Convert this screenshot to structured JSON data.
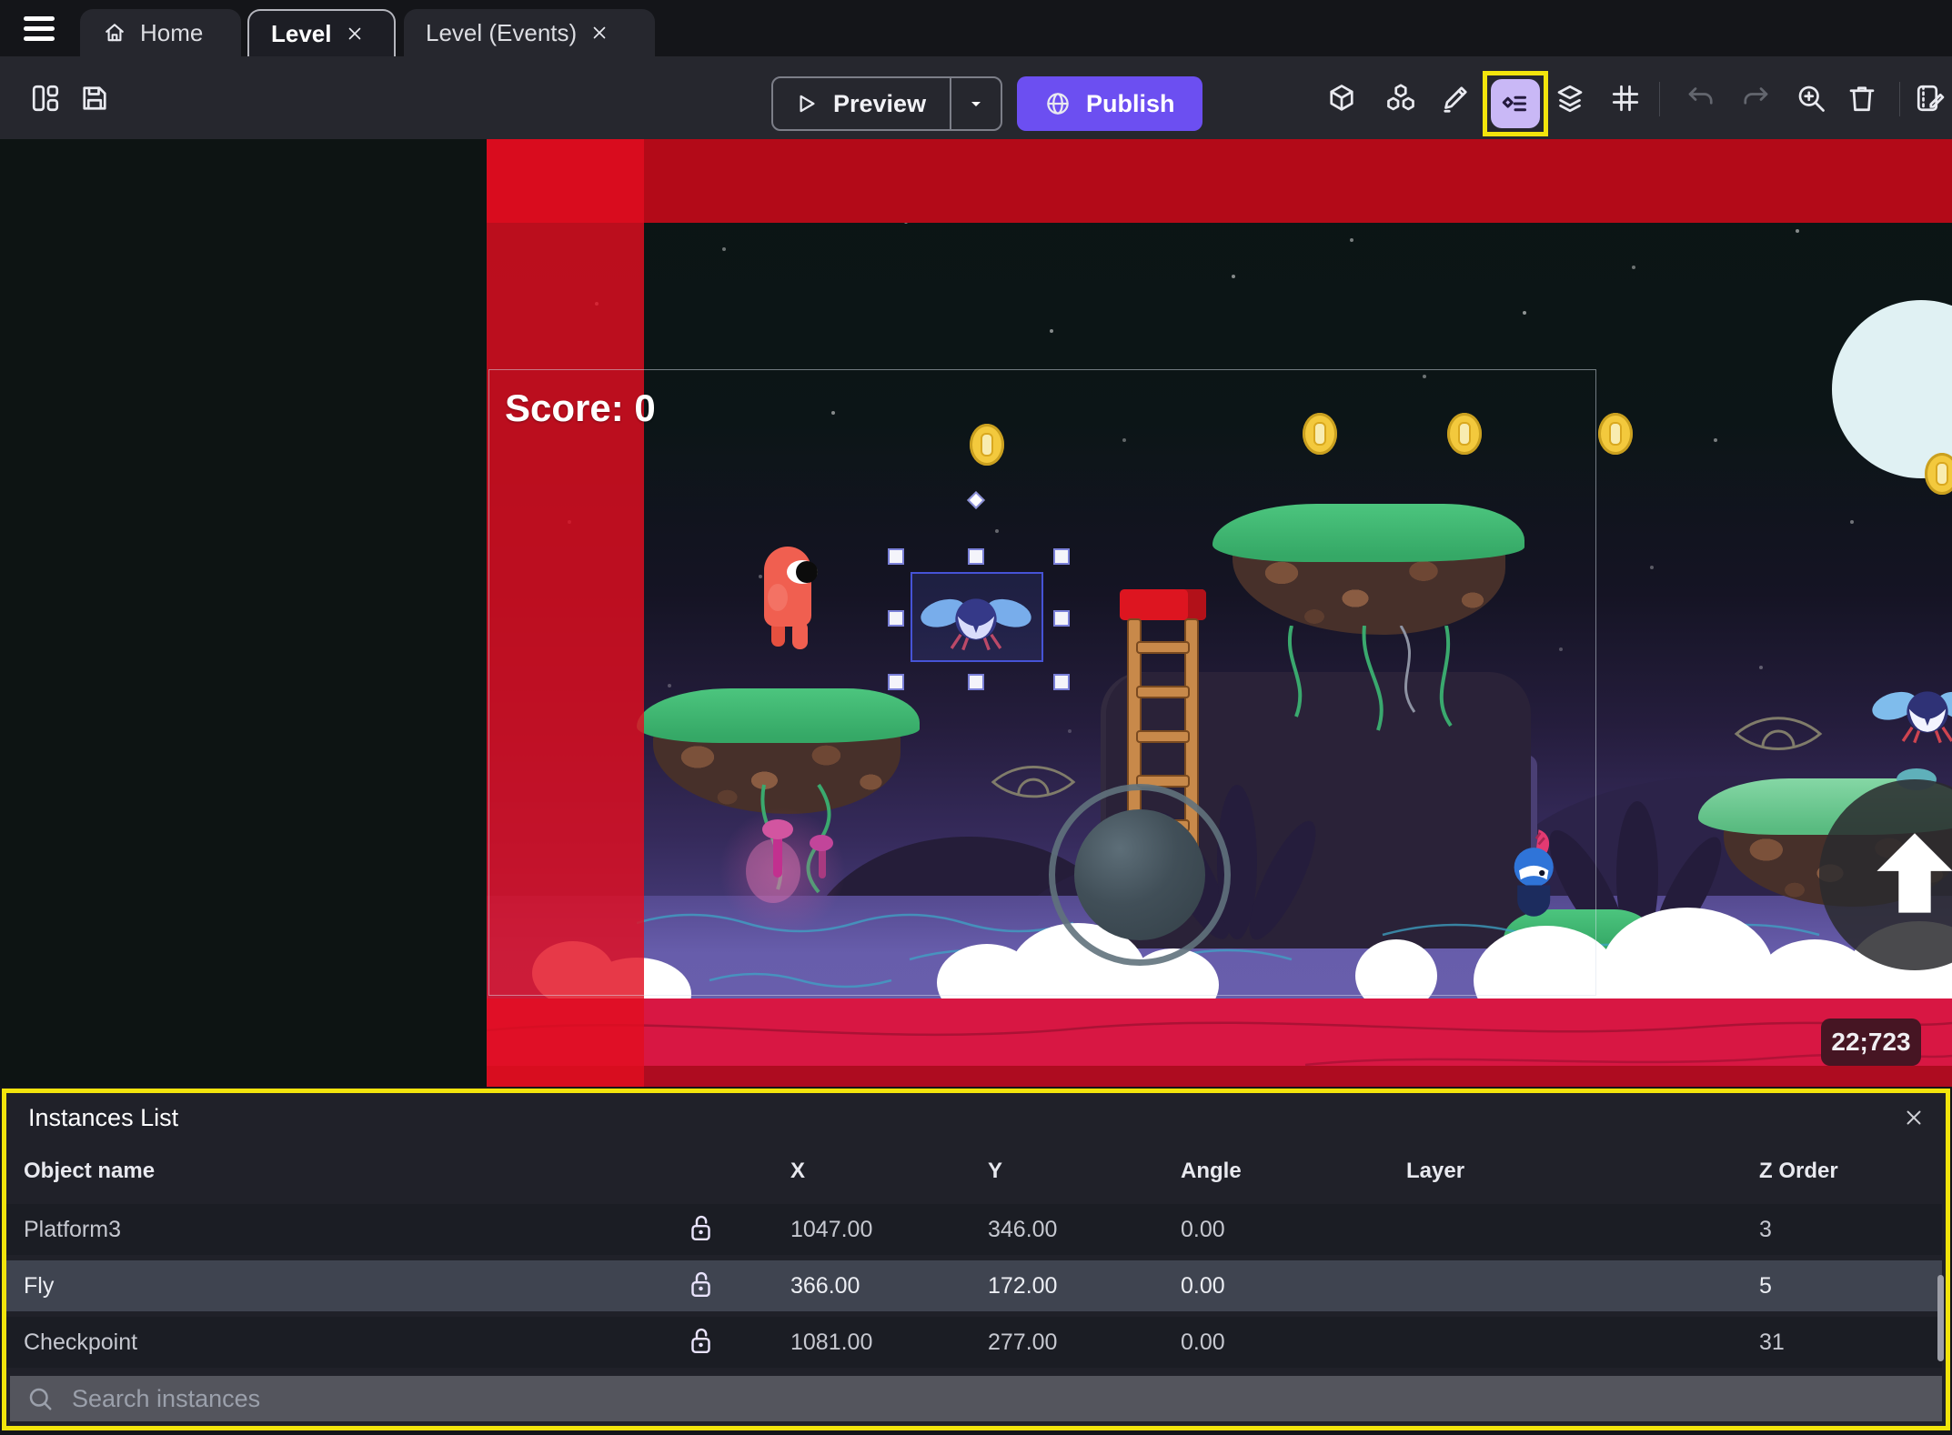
{
  "tabs": {
    "home": "Home",
    "level": "Level",
    "level_events": "Level (Events)"
  },
  "toolbar": {
    "preview": "Preview",
    "publish": "Publish"
  },
  "scene": {
    "score": "Score: 0",
    "cursor_badge": "22;723"
  },
  "instances_panel": {
    "title": "Instances List",
    "columns": [
      "Object name",
      "X",
      "Y",
      "Angle",
      "Layer",
      "Z Order"
    ],
    "rows": [
      {
        "name": "Platform3",
        "x": "1047.00",
        "y": "346.00",
        "angle": "0.00",
        "layer": "",
        "z": "3",
        "selected": false
      },
      {
        "name": "Fly",
        "x": "366.00",
        "y": "172.00",
        "angle": "0.00",
        "layer": "",
        "z": "5",
        "selected": true
      },
      {
        "name": "Checkpoint",
        "x": "1081.00",
        "y": "277.00",
        "angle": "0.00",
        "layer": "",
        "z": "31",
        "selected": false
      }
    ],
    "search_placeholder": "Search instances"
  },
  "colors": {
    "publish_purple": "#6c4ff1",
    "annotation_yellow": "#f2e40c",
    "selection_blue": "#4653d6",
    "highlight_icon_bg": "#c9b8f6",
    "red_band": "#b30a18",
    "red_strip": "#e10e20",
    "crimson_band": "#d81743"
  }
}
